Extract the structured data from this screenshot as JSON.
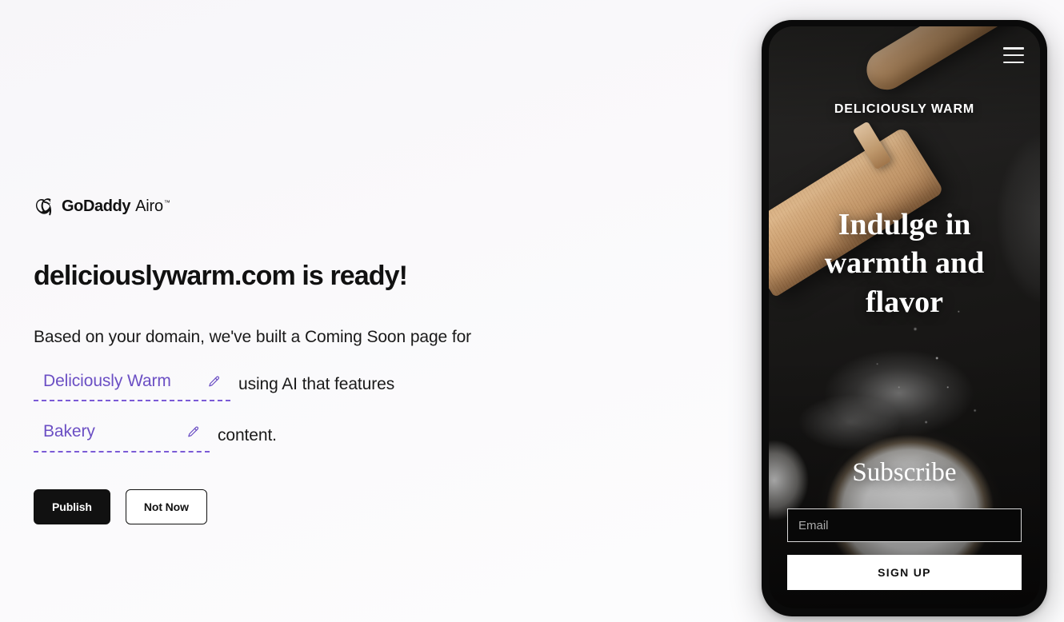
{
  "colors": {
    "accent_purple": "#6b4fc4",
    "dash_purple": "#7b5bd6",
    "primary_dark": "#111111",
    "page_background": "#faf9fb",
    "phone_bezel": "#0a0a0a"
  },
  "brand": {
    "logo_godaddy": "GoDaddy",
    "logo_airo": "Airo",
    "logo_trademark": "™",
    "logo_mark_name": "godaddy-heart-swirl"
  },
  "main": {
    "headline": "deliciouslywarm.com is ready!",
    "paragraph_part_1": "Based on your domain, we've built a Coming Soon page for",
    "paragraph_part_2": "using AI that features",
    "paragraph_part_3": "content.",
    "editable_brand": {
      "value": "Deliciously Warm",
      "edit_icon": "pencil-icon"
    },
    "editable_category": {
      "value": "Bakery",
      "edit_icon": "pencil-icon"
    }
  },
  "actions": {
    "publish_label": "Publish",
    "not_now_label": "Not Now"
  },
  "phone_preview": {
    "menu_icon": "hamburger-menu-icon",
    "site_brand": "DELICIOUSLY WARM",
    "hero_heading": "Indulge in warmth and flavor",
    "subscribe_title": "Subscribe",
    "email_placeholder": "Email",
    "email_value": "",
    "signup_label": "SIGN UP"
  }
}
